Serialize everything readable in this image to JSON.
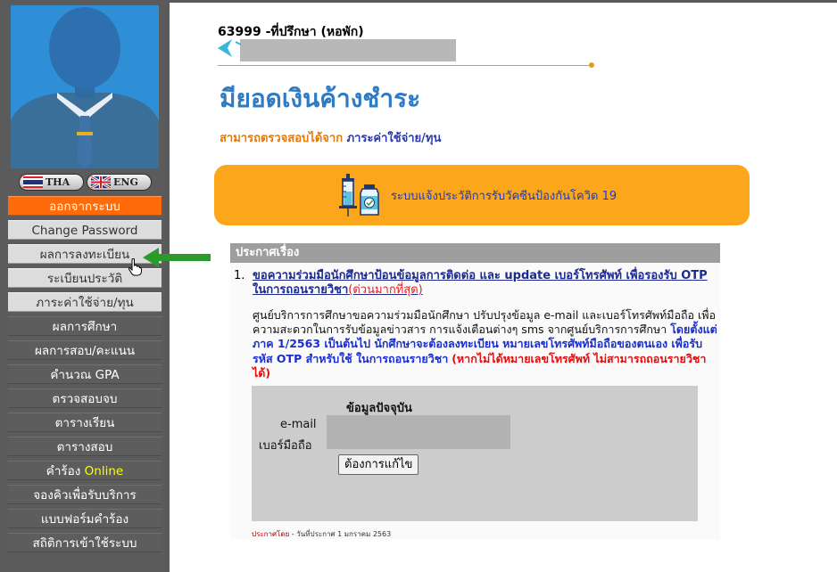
{
  "sidebar": {
    "lang": {
      "tha_label": "THA",
      "eng_label": "ENG"
    },
    "logout_label": "ออกจากระบบ",
    "items": [
      {
        "label": "Change Password",
        "style": "light"
      },
      {
        "label": "ผลการลงทะเบียน",
        "style": "light"
      },
      {
        "label": "ระเบียนประวัติ",
        "style": "light"
      },
      {
        "label": "ภาระค่าใช้จ่าย/ทุน",
        "style": "light"
      },
      {
        "label": "ผลการศึกษา",
        "style": "dark"
      },
      {
        "label": "ผลการสอบ/คะแนน",
        "style": "dark"
      },
      {
        "label": "คำนวณ GPA",
        "style": "dark"
      },
      {
        "label": "ตรวจสอบจบ",
        "style": "dark"
      },
      {
        "label": "ตารางเรียน",
        "style": "dark"
      },
      {
        "label": "ตารางสอบ",
        "style": "dark"
      },
      {
        "label_prefix": "คำร้อง",
        "label_highlight": "Online",
        "style": "dark"
      },
      {
        "label": "จองคิวเพื่อรับบริการ",
        "style": "dark"
      },
      {
        "label": "แบบฟอร์มคำร้อง",
        "style": "dark"
      },
      {
        "label": "สถิติการเข้าใช้ระบบ",
        "style": "dark"
      }
    ]
  },
  "header": {
    "user_line": "63999 -ที่ปรึกษา (หอพัก)"
  },
  "page": {
    "title": "มียอดเงินค้างชำระ",
    "subtitle_prefix": "สามารถตรวจสอบได้จาก",
    "subtitle_link": "ภาระค่าใช้จ่าย/ทุน"
  },
  "vaccine_banner": {
    "text": "ระบบแจ้งประวัติการรับวัคซีนป้องกันโควิด 19"
  },
  "announcements": {
    "header": "ประกาศเรื่อง",
    "items": [
      {
        "number": "1.",
        "title": "ขอความร่วมมือนักศึกษาป้อนข้อมูลการติดต่อ และ update เบอร์โทรศัพท์ เพื่อรองรับ OTP ในการถอนรายวิชา",
        "urgency": "(ด่วนมากที่สุด)",
        "body_normal": "ศูนย์บริการการศึกษาขอความร่วมมือนักศึกษา ปรับปรุงข้อมูล e-mail และเบอร์โทรศัพท์มือถือ เพื่อความสะดวกในการรับข้อมูลข่าวสาร การแจ้งเตือนต่างๆ sms จากศูนย์บริการการศึกษา",
        "body_blue": "โดยตั้งแต่ภาค 1/2563 เป็นต้นไป นักศึกษาจะต้องลงทะเบียน หมายเลขโทรศัพท์มือถือของตนเอง เพื่อรับรหัส OTP สำหรับใช้ ในการถอนรายวิชา",
        "body_red": "(หากไม่ได้หมายเลขโทรศัพท์ ไม่สามารถถอนรายวิชาได้)",
        "panel": {
          "title": "ข้อมูลปัจจุบัน",
          "email_label": "e-mail",
          "phone_label": "เบอร์มือถือ",
          "edit_button": "ต้องการแก้ไข"
        },
        "footer_by": "ประกาศโดย  -",
        "footer_date": "วันที่ประกาศ   1 มกราคม 2563"
      }
    ]
  },
  "colors": {
    "sidebar_bg": "#5b5b5b",
    "logout_bg": "#ff6b0a",
    "title_blue": "#2e7bc4",
    "banner_orange": "#fba61b",
    "arrow_green": "#2a9a2a"
  }
}
